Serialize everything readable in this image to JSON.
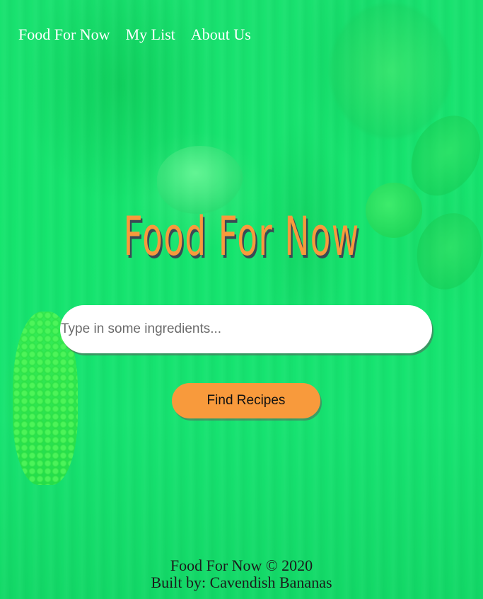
{
  "nav": {
    "items": [
      {
        "label": "Food For Now"
      },
      {
        "label": "My List"
      },
      {
        "label": "About Us"
      }
    ]
  },
  "hero": {
    "title": "Food For Now"
  },
  "search": {
    "placeholder": "Type in some ingredients...",
    "value": ""
  },
  "actions": {
    "find_label": "Find Recipes"
  },
  "footer": {
    "copyright": "Food For Now © 2020",
    "credits": "Built by: Cavendish Bananas"
  },
  "colors": {
    "background": "#1fe06e",
    "accent": "#f89a3c",
    "title_shadow": "#3a4a55",
    "nav_text": "#ffffff"
  }
}
